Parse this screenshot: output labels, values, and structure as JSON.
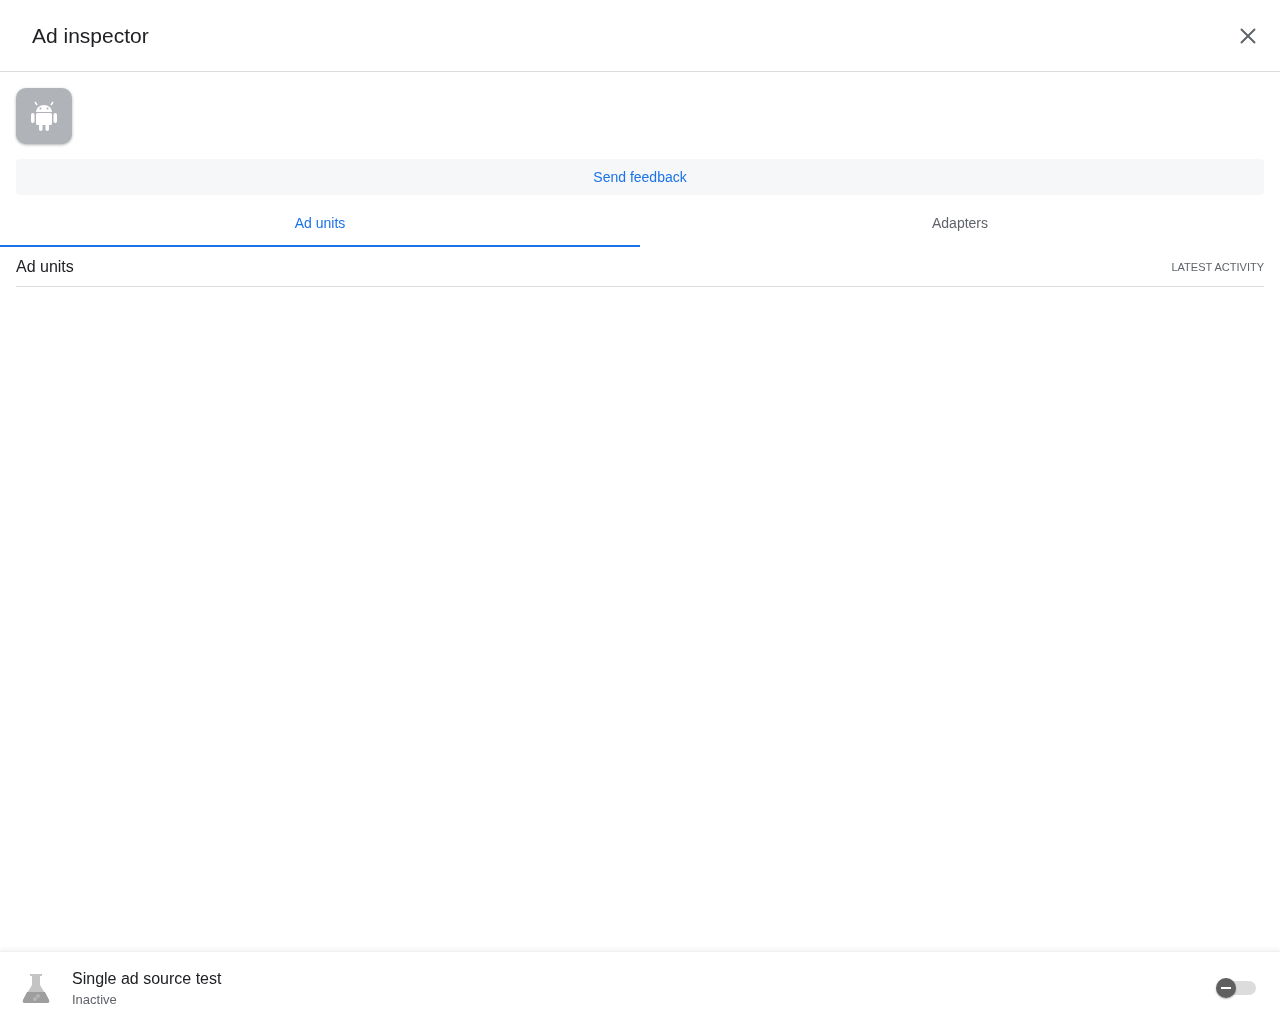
{
  "window": {
    "title": "Ad inspector"
  },
  "feedback": {
    "label": "Send feedback"
  },
  "tabs": [
    {
      "label": "Ad units",
      "selected": true
    },
    {
      "label": "Adapters",
      "selected": false
    }
  ],
  "section": {
    "title": "Ad units",
    "action": "LATEST ACTIVITY"
  },
  "footer": {
    "title": "Single ad source test",
    "status": "Inactive",
    "on": false
  }
}
